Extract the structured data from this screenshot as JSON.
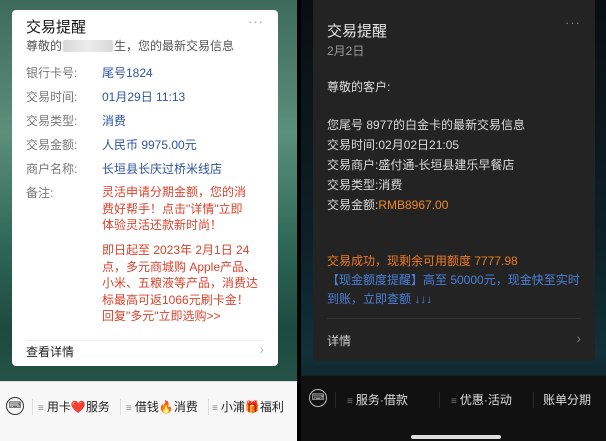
{
  "left": {
    "card": {
      "title": "交易提醒",
      "more": "···",
      "greeting_before": "尊敬的",
      "greeting_after": "生，您的最新交易信息",
      "fields": [
        {
          "key": "银行卡号:",
          "value": "尾号1824"
        },
        {
          "key": "交易时间:",
          "value": "01月29日 11:13"
        },
        {
          "key": "交易类型:",
          "value": "消费"
        },
        {
          "key": "交易金额:",
          "value": "人民币 9975.00元"
        },
        {
          "key": "商户名称:",
          "value": "长垣县长庆过桥米线店"
        }
      ],
      "note_label": "备注:",
      "note_lines_1": [
        "灵活申请分期金额，您的消",
        "费好帮手！点击\"详情\"立即",
        "体验灵活还款新时尚！"
      ],
      "note_lines_2": [
        "即日起至 2023年 2月1日 24",
        "点，多元商城购 Apple产品、",
        "小米、五粮液等产品，消费达",
        "标最高可返1066元刷卡金！",
        "回复\"多元\"立即选购>>"
      ],
      "view_details": "查看详情",
      "chevron": "›"
    },
    "menu": [
      {
        "label": "用卡",
        "emoji": "❤️",
        "suffix": "服务"
      },
      {
        "label": "借钱",
        "emoji": "🔥",
        "suffix": "消费"
      },
      {
        "label": "小浦",
        "emoji": "🎁",
        "suffix": "福利"
      }
    ],
    "keyboard_icon": "⌨"
  },
  "right": {
    "card": {
      "title": "交易提醒",
      "date": "2月2日",
      "more": "···",
      "greeting": "尊敬的客户:",
      "intro": "您尾号 8977的白金卡的最新交易信息",
      "lines": [
        {
          "key": "交易时间:",
          "value": "02月02日21:05"
        },
        {
          "key": "交易商户:",
          "value": "盛付通-长垣县建乐早餐店"
        },
        {
          "key": "交易类型:",
          "value": "消费"
        }
      ],
      "amount_key": "交易金额:",
      "amount_value": "RMB8967.00",
      "success": "交易成功，现剩余可用额度 7777.98",
      "promo": "【现金额度提醒】高至 50000元，现金快至实时到账，立即查额 ↓↓↓",
      "details": "详情",
      "chevron": "›"
    },
    "menu": [
      {
        "label": "服务·借款"
      },
      {
        "label": "优惠·活动"
      },
      {
        "label": "账单分期"
      }
    ],
    "keyboard_icon": "⌨"
  },
  "colors": {
    "link_blue": "#2f54a0",
    "note_red": "#d8432e",
    "amount_orange": "#f08a2a",
    "promo_blue": "#4a80d9"
  }
}
